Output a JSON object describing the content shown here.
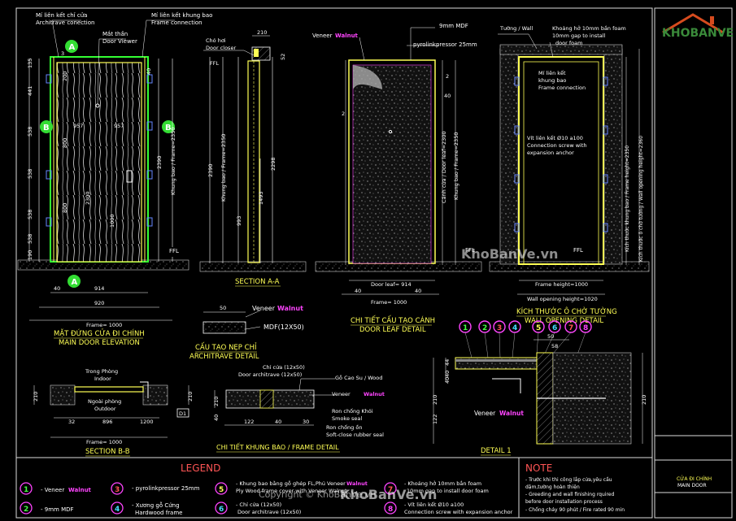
{
  "watermark": {
    "logo_text": "KHOBANVE",
    "site1": "KhoBanVe.vn",
    "site2": "KhoBanVe.vn",
    "copyright": "Copyright © KhoBanVe.vn"
  },
  "elevation": {
    "title_vi": "MẶT ĐỨNG CỬA ĐI CHÍNH",
    "title_en": "MAIN DOOR ELEVATION",
    "callout_architrave_vi": "Mí liên kết chỉ cửa",
    "callout_architrave_en": "Architrave conection",
    "callout_viewer_vi": "Mắt thần",
    "callout_viewer_en": "Door Viewer",
    "callout_frame_vi": "Mí liên kết khung bao",
    "callout_frame_en": "Frame connection",
    "dims_left": [
      "135",
      "441",
      "538",
      "538",
      "538",
      "538",
      "190"
    ],
    "dims_inner": [
      "200",
      "800",
      "800",
      "40"
    ],
    "dim_top": "3",
    "dim_957a": "957",
    "dim_957b": "957",
    "dim_2300": "2300",
    "dim_1000": "1000",
    "dim_2390": "2390",
    "dim_frame_v": "Khung bao / Frame=2350",
    "dim_40": "40",
    "dim_914": "914",
    "dim_920": "920",
    "dim_frame_h": "Frame= 1000",
    "ffl": "FFL",
    "tags": [
      "A",
      "B",
      "B",
      "A"
    ]
  },
  "section_aa": {
    "title": "SECTION A-A",
    "callout_vi": "Chó hơi",
    "callout_en": "Door closer",
    "dim_210": "210",
    "dim_52": "52",
    "dim_2390": "2390",
    "dim_frame_v": "Khung bao / Frame=2350",
    "dim_2298": "2298",
    "dim_1493": "1493",
    "dim_993": "993",
    "ffl": "FFL"
  },
  "door_leaf": {
    "title_vi": "CHI TIẾT CẤU TẠO CÁNH",
    "title_en": "DOOR LEAF DETAIL",
    "veneer_label": "Veneer",
    "veneer_name": "Walnut",
    "mdf": "9mm MDF",
    "pyrolink": "pyrolinkpressor 25mm",
    "dim_2": "2",
    "dim_40": "40",
    "dim_leaf_v": "Cánh cửa / Door leaf=2300",
    "dim_frame_v": "Khung bao / Frame=2350",
    "dim_leaf_h": "Door leaf= 914",
    "dim_40b": "40",
    "dim_frame_h": "Frame= 1000",
    "ffl": "FFL"
  },
  "wall_opening": {
    "title_vi": "KÍCH THƯỚC Ô CHỜ TƯỜNG",
    "title_en": "WALL OPENING DETAIL",
    "wall_label": "Tường / Wall",
    "gap_vi": "Khoảng hở 10mm bắn foam",
    "gap_en1": "10mm gap to install",
    "gap_en2": "door foam",
    "frame_conn_vi1": "Mí liên kết",
    "frame_conn_vi2": "khung bao",
    "frame_conn_en": "Frame connection",
    "screw_vi": "Vít liên kết Ø10 a100",
    "screw_en1": "Connection screw with",
    "screw_en2": "expansion anchor",
    "dim_frame_v": "Kích thước khung bao / Frame height=2350",
    "dim_wall_v": "Kích thước ô chờ tường / Wall opening height=2360",
    "frame_height": "Frame height=1000",
    "wall_opening_height": "Wall opening height=1020",
    "ffl": "FFL"
  },
  "architrave": {
    "title_vi": "CẤU TẠO NẸP CHỈ",
    "title_en": "ARCHITRAVE DETAIL",
    "dim_50": "50",
    "veneer_label": "Veneer",
    "veneer_name": "Walnut",
    "mdf": "MDF(12X50)"
  },
  "section_bb": {
    "title": "SECTION B-B",
    "indoor_vi": "Trong Phòng",
    "indoor_en": "Indoor",
    "outdoor_vi": "Ngoài phòng",
    "outdoor_en": "Outdoor",
    "dim_210a": "210",
    "dim_210b": "210",
    "dim_32": "32",
    "dim_896": "896",
    "dim_1200": "1200",
    "dim_frame_h": "Frame= 1000",
    "tag_d1": "D1"
  },
  "frame_detail": {
    "title": "CHI TIẾT KHUNG BAO / FRAME DETAIL",
    "wood": "Gỗ Cao Su / Wood",
    "veneer_label": "Veneer",
    "veneer_name": "Walnut",
    "chi_cua": "Chỉ cửa (12x50)",
    "architrave": "Door architrave (12x50)",
    "smoke_vi": "Ron chống Khói",
    "smoke_en": "Smoke seal",
    "rubber_vi": "Ron chống ồn",
    "rubber_en": "Soft-close rubber seal",
    "dim_210": "210",
    "dim_40": "40",
    "dim_122": "122",
    "dim_40b": "40",
    "dim_30": "30"
  },
  "detail1": {
    "title": "DETAIL 1",
    "numbers": [
      "1",
      "2",
      "3",
      "4",
      "5",
      "6",
      "7",
      "8"
    ],
    "dim_50": "50",
    "dim_58": "58",
    "dim_210a": "210",
    "dim_210b": "210",
    "dim_122": "122",
    "dim_40": "40",
    "dim_44": "44",
    "dim_40b": "40",
    "veneer_label": "Veneer",
    "veneer_name": "Walnut"
  },
  "legend": {
    "title": "LEGEND",
    "items": [
      {
        "n": "1",
        "text": "- Veneer",
        "accent": "Walnut"
      },
      {
        "n": "2",
        "text": "- 9mm MDF",
        "accent": ""
      },
      {
        "n": "3",
        "text": "- pyrolinkpressor 25mm",
        "accent": ""
      },
      {
        "n": "4",
        "text": "- Xương gỗ Cứng",
        "text2": "Hardwood frame",
        "accent": ""
      },
      {
        "n": "5",
        "text": "- Khung bao bằng gỗ ghép FL,Phủ Veneer",
        "accent": "Walnut",
        "text2": "Ply Wood frame cover with Veneer Walnut"
      },
      {
        "n": "6",
        "text": "- Chỉ cửa (12x50)",
        "text2": "Door architrave (12x50)",
        "accent": ""
      },
      {
        "n": "7",
        "text": "- Khoảng hở 10mm bắn foam",
        "text2": "10mm gap to install door foam",
        "accent": ""
      },
      {
        "n": "8",
        "text": "- Vít liên kết Ø10 a100",
        "text2": "Connection screw with expansion anchor",
        "accent": ""
      }
    ]
  },
  "note": {
    "title": "NOTE",
    "lines": [
      "- Trước khi thi công lắp cửa,yêu cầu",
      "  dặm,tường hoàn thiện",
      "- Greeding and wall finishing rquired",
      "  before door installation process",
      "- Chống cháy 90 phút / Fire rated 90 min"
    ]
  },
  "title_block": {
    "title_vi": "CỬA ĐI CHÍNH",
    "title_en": "MAIN DOOR"
  },
  "colors": {
    "background": "#000000",
    "frame": "#ffff00",
    "wood": "#b87a3a",
    "accent": "#ff44ff",
    "green": "#33ff33",
    "magenta_ring": "#ff44ff"
  }
}
